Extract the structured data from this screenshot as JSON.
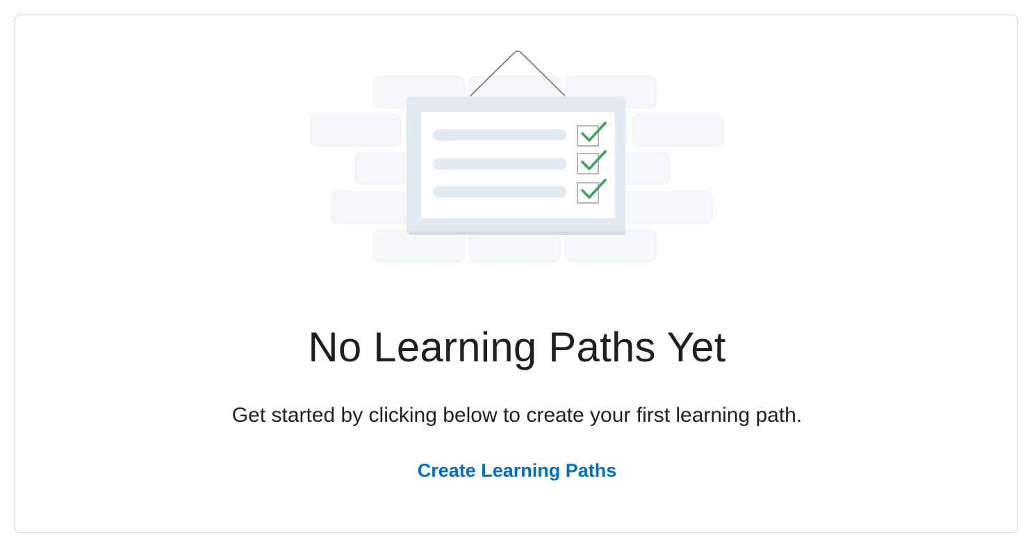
{
  "empty_state": {
    "title": "No Learning Paths Yet",
    "description": "Get started by clicking below to create your first learning path.",
    "action_label": "Create Learning Paths",
    "illustration_icon": "checklist-board-icon"
  },
  "colors": {
    "link": "#006fbf",
    "check": "#3ea061",
    "border": "#cdd5dc"
  }
}
